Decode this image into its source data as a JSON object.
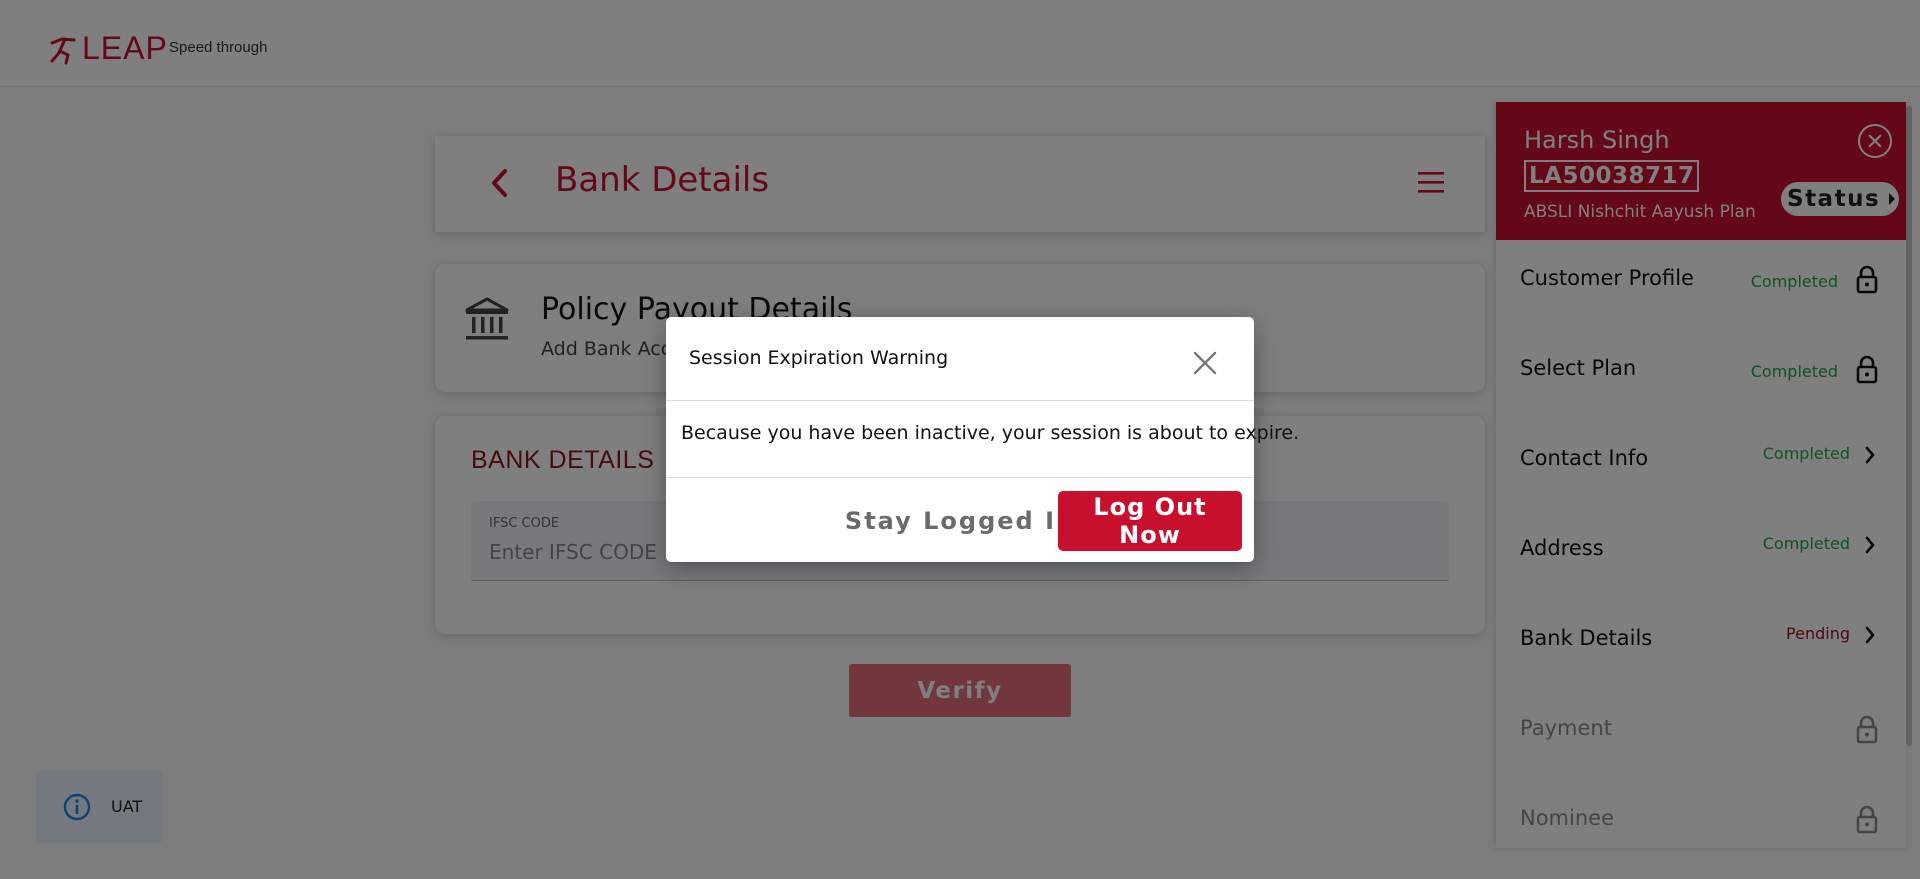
{
  "header": {
    "logo_text": "LEAP",
    "tagline": "Speed through"
  },
  "page": {
    "title": "Bank Details"
  },
  "payout": {
    "title": "Policy Payout Details",
    "subtitle": "Add Bank Account"
  },
  "bank_form": {
    "heading": "BANK DETAILS",
    "ifsc_label": "IFSC CODE",
    "ifsc_placeholder": "Enter IFSC CODE",
    "ifsc_value": "",
    "verify_label": "Verify"
  },
  "env_badge": {
    "label": "UAT",
    "icon": "info-icon"
  },
  "side_panel": {
    "customer_name": "Harsh Singh",
    "application_id": "LA50038717",
    "plan_name": "ABSLI Nishchit Aayush Plan",
    "status_label": "Status",
    "steps": [
      {
        "label": "Customer Profile",
        "status": "Completed",
        "icon": "lock-icon"
      },
      {
        "label": "Select Plan",
        "status": "Completed",
        "icon": "lock-icon"
      },
      {
        "label": "Contact Info",
        "status": "Completed",
        "icon": "chevron-right-icon"
      },
      {
        "label": "Address",
        "status": "Completed",
        "icon": "chevron-right-icon"
      },
      {
        "label": "Bank Details",
        "status": "Pending",
        "icon": "chevron-right-icon"
      },
      {
        "label": "Payment",
        "status": "",
        "icon": "lock-icon"
      },
      {
        "label": "Nominee",
        "status": "",
        "icon": "lock-icon"
      }
    ]
  },
  "modal": {
    "title": "Session Expiration Warning",
    "message": "Because you have been inactive, your session is about to expire.",
    "stay_label": "Stay Logged In",
    "logout_label": "Log Out Now"
  },
  "colors": {
    "brand_red": "#c8102e",
    "completed_green": "#22a24a",
    "pending_maroon": "#8b1820",
    "verify_disabled": "#e46e79",
    "uat_bg": "#e6f2fc"
  }
}
